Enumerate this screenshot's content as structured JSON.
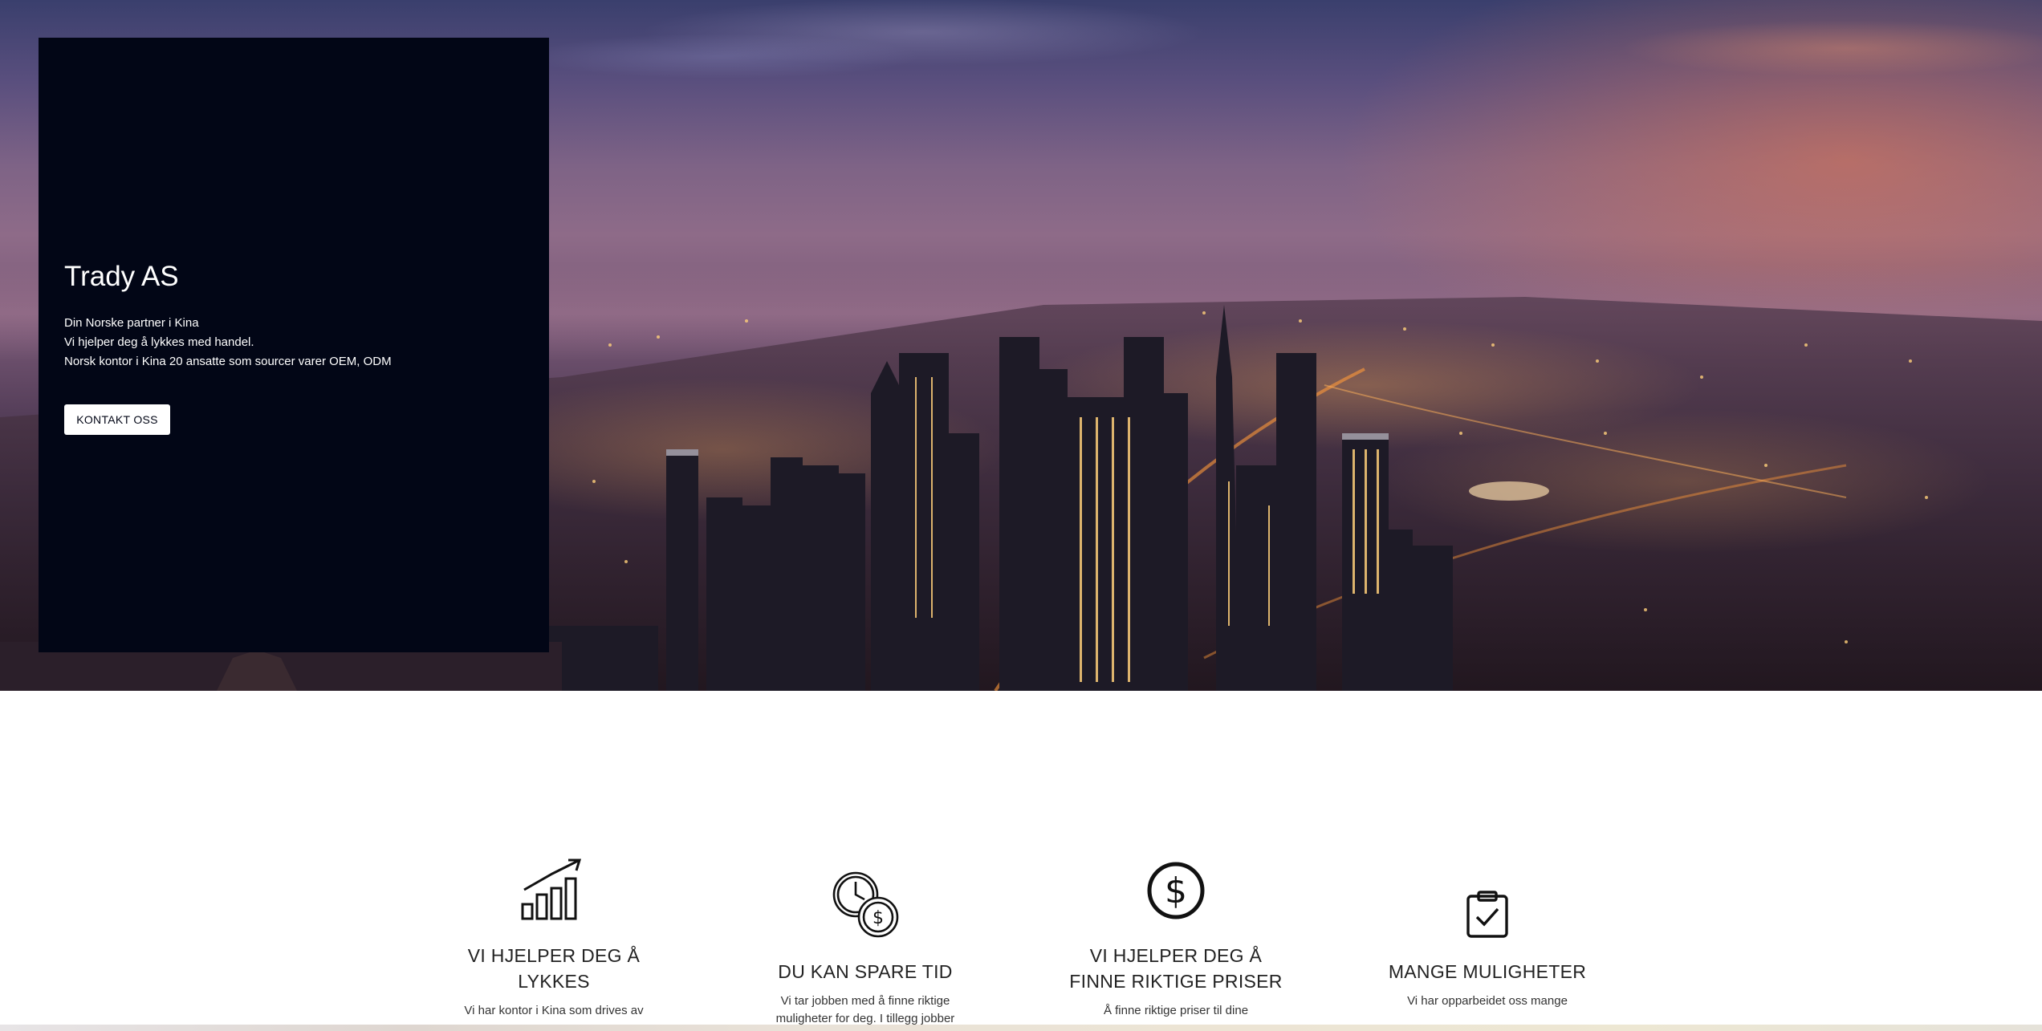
{
  "hero": {
    "title": "Trady AS",
    "lines": [
      "Din Norske partner i Kina",
      "Vi hjelper deg å lykkes med handel.",
      "Norsk kontor i Kina 20 ansatte som sourcer varer OEM, ODM"
    ],
    "button_label": "KONTAKT OSS",
    "background_image": "city-skyline-at-dusk"
  },
  "features": [
    {
      "icon": "growth-chart-icon",
      "title_lines": [
        "VI HJELPER DEG Å",
        "LYKKES"
      ],
      "text": "Vi har kontor i Kina som drives av"
    },
    {
      "icon": "clock-money-icon",
      "title_lines": [
        "DU KAN SPARE TID"
      ],
      "text_lines": [
        "Vi tar jobben med å finne riktige",
        "muligheter for deg. I tillegg jobber"
      ]
    },
    {
      "icon": "dollar-circle-icon",
      "title_lines": [
        "VI HJELPER DEG Å",
        "FINNE RIKTIGE PRISER"
      ],
      "text": "Å finne riktige priser til dine"
    },
    {
      "icon": "clipboard-check-icon",
      "title_lines": [
        "MANGE MULIGHETER"
      ],
      "text": "Vi har opparbeidet oss mange"
    }
  ],
  "colors": {
    "panel_background": "#020616",
    "button_background": "#ffffff",
    "heading_text": "#222222"
  }
}
